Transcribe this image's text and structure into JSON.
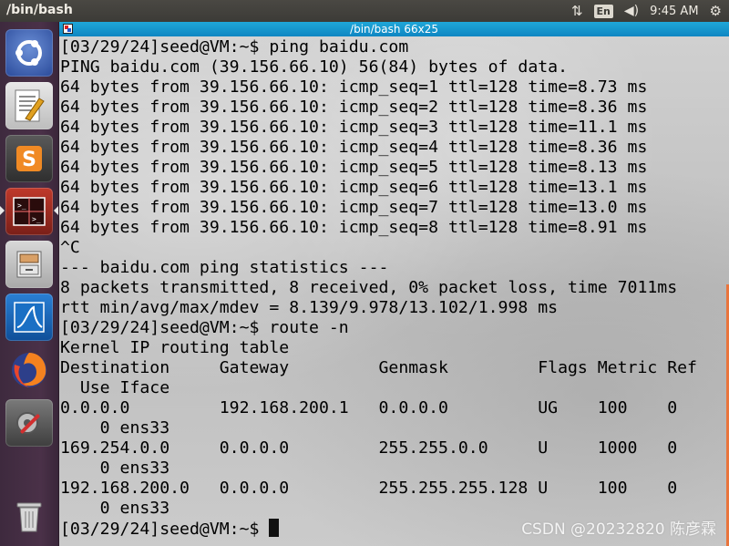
{
  "top_bar": {
    "app_title": "/bin/bash",
    "network_icon": "network-updown-icon",
    "keyboard_layout": "En",
    "volume_icon": "volume-icon",
    "clock": "9:45 AM",
    "settings_icon": "gear-icon"
  },
  "launcher": {
    "items": [
      {
        "name": "ubuntu-dash-icon"
      },
      {
        "name": "text-editor-icon"
      },
      {
        "name": "sublime-text-icon"
      },
      {
        "name": "terminal-app-icon"
      },
      {
        "name": "file-manager-icon"
      },
      {
        "name": "wireshark-icon"
      },
      {
        "name": "firefox-icon"
      },
      {
        "name": "system-settings-icon"
      },
      {
        "name": "trash-icon"
      }
    ]
  },
  "terminal": {
    "title": "/bin/bash 66x25",
    "lines": [
      "[03/29/24]seed@VM:~$ ping baidu.com",
      "PING baidu.com (39.156.66.10) 56(84) bytes of data.",
      "64 bytes from 39.156.66.10: icmp_seq=1 ttl=128 time=8.73 ms",
      "64 bytes from 39.156.66.10: icmp_seq=2 ttl=128 time=8.36 ms",
      "64 bytes from 39.156.66.10: icmp_seq=3 ttl=128 time=11.1 ms",
      "64 bytes from 39.156.66.10: icmp_seq=4 ttl=128 time=8.36 ms",
      "64 bytes from 39.156.66.10: icmp_seq=5 ttl=128 time=8.13 ms",
      "64 bytes from 39.156.66.10: icmp_seq=6 ttl=128 time=13.1 ms",
      "64 bytes from 39.156.66.10: icmp_seq=7 ttl=128 time=13.0 ms",
      "64 bytes from 39.156.66.10: icmp_seq=8 ttl=128 time=8.91 ms",
      "^C",
      "--- baidu.com ping statistics ---",
      "8 packets transmitted, 8 received, 0% packet loss, time 7011ms",
      "rtt min/avg/max/mdev = 8.139/9.978/13.102/1.998 ms",
      "[03/29/24]seed@VM:~$ route -n",
      "Kernel IP routing table",
      "Destination     Gateway         Genmask         Flags Metric Ref",
      "  Use Iface",
      "0.0.0.0         192.168.200.1   0.0.0.0         UG    100    0",
      "    0 ens33",
      "169.254.0.0     0.0.0.0         255.255.0.0     U     1000   0",
      "    0 ens33",
      "192.168.200.0   0.0.0.0         255.255.255.128 U     100    0",
      "    0 ens33"
    ],
    "prompt": "[03/29/24]seed@VM:~$ "
  },
  "watermark": "CSDN @20232820 陈彦霖",
  "colors": {
    "titlebar": "#1fa7d9",
    "launcher": "#4a3148",
    "top_bar": "#3c3b37",
    "scroll_accent": "#e9743c"
  }
}
